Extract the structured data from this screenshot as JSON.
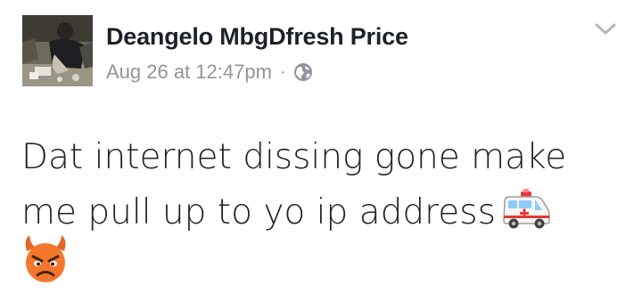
{
  "post": {
    "author_name": "Deangelo MbgDfresh Price",
    "timestamp": "Aug 26 at 12:47pm",
    "separator": "·",
    "privacy_icon": "globe-icon",
    "menu_icon": "chevron-down-icon",
    "text_lines": [
      "Dat internet dissing gone make",
      "me pull up to yo ip address"
    ],
    "emojis": [
      "ambulance-emoji",
      "angry-devil-emoji"
    ]
  },
  "colors": {
    "name": "#1d2129",
    "meta": "#90949c",
    "body_text": "#1d2129",
    "devil_orange": "#f4782c"
  }
}
